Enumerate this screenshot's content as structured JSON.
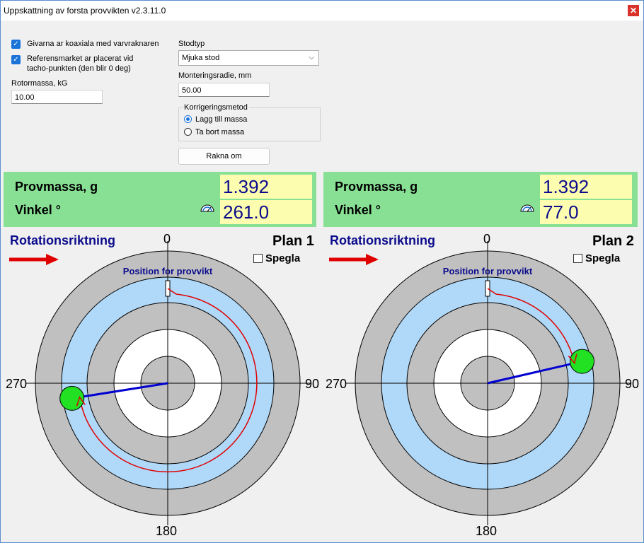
{
  "window": {
    "title": "Uppskattning av forsta provvikten v2.3.11.0",
    "close_glyph": "✕"
  },
  "settings": {
    "coaxial_checkbox": {
      "label": "Givarna ar koaxiala med varvraknaren",
      "checked": true
    },
    "reference_checkbox": {
      "label_line1": "Referensmarket ar placerat vid",
      "label_line2": "tacho-punkten (den blir 0 deg)",
      "checked": true
    },
    "rotor_mass": {
      "label": "Rotormassa, kG",
      "value": "10.00"
    },
    "support_type": {
      "label": "Stodtyp",
      "value": "Mjuka stod"
    },
    "mount_radius": {
      "label": "Monteringsradie, mm",
      "value": "50.00"
    },
    "correction": {
      "title": "Korrigeringsmetod",
      "options": [
        {
          "label": "Lagg till massa",
          "selected": true
        },
        {
          "label": "Ta bort massa",
          "selected": false
        }
      ]
    },
    "recalc_button": "Rakna om"
  },
  "planes": [
    {
      "trial_mass_label": "Provmassa, g",
      "trial_mass_value": "1.392",
      "angle_label": "Vinkel  °",
      "angle_value": "261.0",
      "angle_deg": 261.0,
      "rotation_label": "Rotationsriktning",
      "plan_label": "Plan 1",
      "mirror_label": "Spegla",
      "mirror_checked": false,
      "position_label": "Position for provvikt"
    },
    {
      "trial_mass_label": "Provmassa, g",
      "trial_mass_value": "1.392",
      "angle_label": "Vinkel  °",
      "angle_value": "77.0",
      "angle_deg": 77.0,
      "rotation_label": "Rotationsriktning",
      "plan_label": "Plan 2",
      "mirror_label": "Spegla",
      "mirror_checked": false,
      "position_label": "Position for provvikt"
    }
  ],
  "axis_labels": {
    "top": "0",
    "right": "90",
    "bottom": "180",
    "left": "270"
  },
  "colors": {
    "panel_green": "#88e094",
    "value_yellow": "#fdfdb0",
    "value_text": "#0b0b8c",
    "ring_gray": "#c0c0c0",
    "ring_blue": "#b0d8f8",
    "arc_red": "#e00000",
    "vector_blue": "#0000d0",
    "weight_green": "#22e022"
  },
  "icons": {
    "angle_gauge": "protractor-icon",
    "rotation_arrow": "arrow-right-icon"
  }
}
